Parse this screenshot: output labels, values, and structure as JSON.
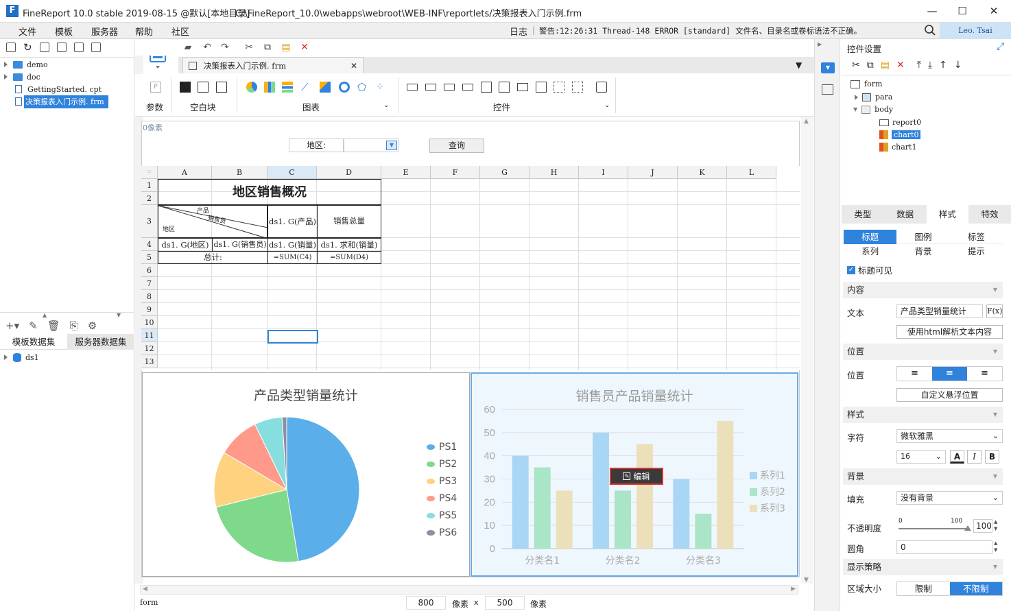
{
  "window": {
    "title": "FineReport 10.0 stable 2019-08-15 @默认[本地目录]",
    "path": "C:\\FineReport_10.0\\webapps\\webroot\\WEB-INF\\reportlets/决策报表入门示例.frm",
    "logo_letter": "F"
  },
  "menu": {
    "items": [
      "文件",
      "模板",
      "服务器",
      "帮助",
      "社区"
    ],
    "log": "日志",
    "warning": "警告:12:26:31 Thread-148 ERROR [standard] 文件名、目录名或卷标语法不正确。",
    "user": "Leo. Tsai"
  },
  "file_tree": {
    "items": [
      {
        "label": "demo",
        "type": "folder"
      },
      {
        "label": "doc",
        "type": "folder"
      },
      {
        "label": "GettingStarted. cpt",
        "type": "file"
      },
      {
        "label": "决策报表入门示例. frm",
        "type": "file",
        "selected": true
      }
    ]
  },
  "dataset_panel": {
    "tabs": [
      "模板数据集",
      "服务器数据集"
    ],
    "datasets": [
      "ds1"
    ]
  },
  "editor_tab": {
    "label": "决策报表入门示例. frm"
  },
  "ribbon": {
    "groups": [
      {
        "label": "参数"
      },
      {
        "label": "空白块"
      },
      {
        "label": "图表"
      },
      {
        "label": "控件"
      }
    ]
  },
  "param_pane": {
    "size_label": "0像素",
    "region_label": "地区:",
    "query_button": "查询"
  },
  "sheet": {
    "columns": [
      "A",
      "B",
      "C",
      "D",
      "E",
      "F",
      "G",
      "H",
      "I",
      "J",
      "K",
      "L"
    ],
    "rows": [
      "1",
      "2",
      "3",
      "4",
      "5",
      "6",
      "7",
      "8",
      "9",
      "10",
      "11",
      "12",
      "13"
    ],
    "title": "地区销售概况",
    "diag_product": "产品",
    "diag_seller": "销售员",
    "diag_region": "地区",
    "c3": "ds1. G(产品)",
    "d3": "销售总量",
    "a4": "ds1. G(地区)",
    "b4": "ds1. G(销售员)",
    "c4": "ds1. G(销量)",
    "d4": "ds1. 求和(销量)",
    "ab5": "总计:",
    "c5": "=SUM(C4)",
    "d5": "=SUM(D4)"
  },
  "chart_data": [
    {
      "type": "pie",
      "title": "产品类型销量统计",
      "categories": [
        "PS1",
        "PS2",
        "PS3",
        "PS4",
        "PS5",
        "PS6"
      ],
      "values": [
        46,
        23,
        12,
        9,
        6,
        1
      ],
      "colors": [
        "#5aaeea",
        "#7ed98a",
        "#ffd27f",
        "#ff9a8a",
        "#86dede",
        "#8b8fa0"
      ],
      "legend": "right"
    },
    {
      "type": "bar",
      "title": "销售员产品销量统计",
      "categories": [
        "分类名1",
        "分类名2",
        "分类名3"
      ],
      "series": [
        {
          "name": "系列1",
          "values": [
            40,
            50,
            30
          ],
          "color": "#aad6f5"
        },
        {
          "name": "系列2",
          "values": [
            35,
            25,
            15
          ],
          "color": "#a9e5c6"
        },
        {
          "name": "系列3",
          "values": [
            25,
            45,
            55
          ],
          "color": "#ece0bb"
        }
      ],
      "ylim": [
        0,
        60
      ],
      "yticks": [
        0,
        10,
        20,
        30,
        40,
        50,
        60
      ],
      "legend": "right",
      "grid": true,
      "edit_label": "编辑"
    }
  ],
  "status": {
    "left": "form",
    "width": "800",
    "px1": "像素",
    "x": "x",
    "height": "500",
    "px2": "像素"
  },
  "right_panel": {
    "title": "控件设置",
    "tree": [
      "form",
      "para",
      "body",
      "report0",
      "chart0",
      "chart1"
    ],
    "tabs": [
      "类型",
      "数据",
      "样式",
      "特效"
    ],
    "subtabs": [
      "标题",
      "图例",
      "标签",
      "系列",
      "背景",
      "提示"
    ],
    "title_visible": "标题可见",
    "sec_content": "内容",
    "text_label": "文本",
    "text_value": "产品类型销量统计",
    "fx": "F(x)",
    "html_btn": "使用html解析文本内容",
    "sec_position": "位置",
    "pos_label": "位置",
    "float_btn": "自定义悬浮位置",
    "sec_style": "样式",
    "font_label": "字符",
    "font_value": "微软雅黑",
    "font_size": "16",
    "sec_bg": "背景",
    "fill_label": "填充",
    "fill_value": "没有背景",
    "opacity_label": "不透明度",
    "slider_min": "0",
    "slider_max": "100",
    "opacity_value": "100",
    "radius_label": "圆角",
    "radius_value": "0",
    "sec_display": "显示策略",
    "area_label": "区域大小",
    "limit": "限制",
    "nolimit": "不限制"
  }
}
